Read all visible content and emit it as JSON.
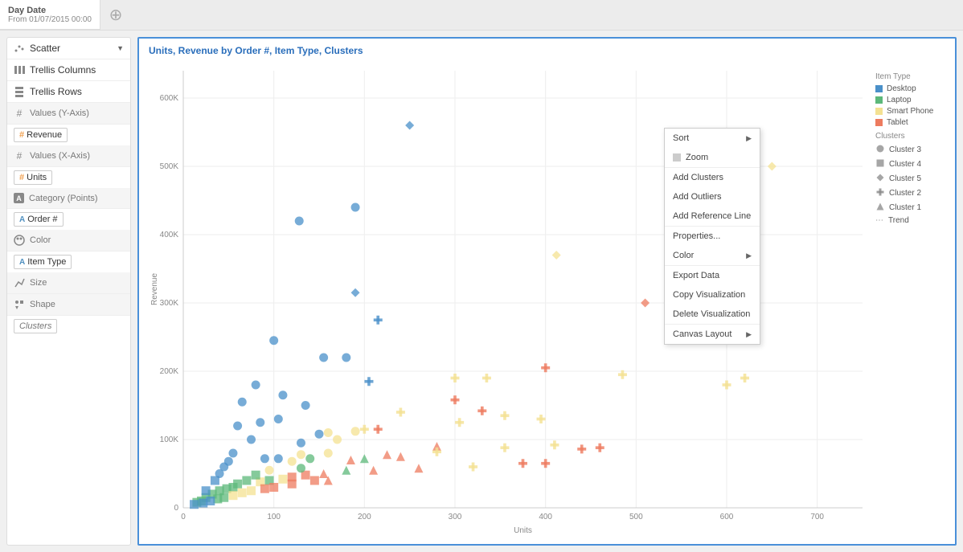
{
  "topbar": {
    "filter_title": "Day Date",
    "filter_sub": "From 01/07/2015 00:00"
  },
  "sidebar": {
    "viz_type": "Scatter",
    "trellis_cols": "Trellis Columns",
    "trellis_rows": "Trellis Rows",
    "y_axis_label": "Values (Y-Axis)",
    "y_axis_chip": "Revenue",
    "x_axis_label": "Values (X-Axis)",
    "x_axis_chip": "Units",
    "category_label": "Category (Points)",
    "category_chip": "Order #",
    "color_label": "Color",
    "color_chip": "Item Type",
    "size_label": "Size",
    "shape_label": "Shape",
    "shape_chip": "Clusters"
  },
  "chart": {
    "title": "Units, Revenue by Order #, Item Type, Clusters",
    "xlabel": "Units",
    "ylabel": "Revenue"
  },
  "legend": {
    "item_type_title": "Item Type",
    "item_types": [
      {
        "label": "Desktop",
        "color": "#4a90c9"
      },
      {
        "label": "Laptop",
        "color": "#5cb87a"
      },
      {
        "label": "Smart Phone",
        "color": "#f4e192"
      },
      {
        "label": "Tablet",
        "color": "#ed7b5f"
      }
    ],
    "clusters_title": "Clusters",
    "clusters": [
      {
        "label": "Cluster 3",
        "shape": "circle"
      },
      {
        "label": "Cluster 4",
        "shape": "square"
      },
      {
        "label": "Cluster 5",
        "shape": "diamond"
      },
      {
        "label": "Cluster 2",
        "shape": "plus"
      },
      {
        "label": "Cluster 1",
        "shape": "triangle"
      }
    ],
    "trend_label": "Trend"
  },
  "context_menu": {
    "sort": "Sort",
    "zoom": "Zoom",
    "add_clusters": "Add Clusters",
    "add_outliers": "Add Outliers",
    "add_ref": "Add Reference Line",
    "properties": "Properties...",
    "color": "Color",
    "export": "Export Data",
    "copy": "Copy Visualization",
    "delete": "Delete Visualization",
    "canvas": "Canvas Layout"
  },
  "chart_data": {
    "type": "scatter",
    "xlabel": "Units",
    "ylabel": "Revenue",
    "xlim": [
      0,
      750
    ],
    "ylim": [
      0,
      640000
    ],
    "x_ticks": [
      0,
      100,
      200,
      300,
      400,
      500,
      600,
      700
    ],
    "y_ticks": [
      0,
      100000,
      200000,
      300000,
      400000,
      500000,
      600000
    ],
    "y_tick_labels": [
      "0",
      "100K",
      "200K",
      "300K",
      "400K",
      "500K",
      "600K"
    ],
    "colors": {
      "Desktop": "#4a90c9",
      "Laptop": "#5cb87a",
      "Smart Phone": "#f4e192",
      "Tablet": "#ed7b5f"
    },
    "shapes": {
      "Cluster 1": "triangle",
      "Cluster 2": "plus",
      "Cluster 3": "circle",
      "Cluster 4": "square",
      "Cluster 5": "diamond"
    },
    "points": [
      {
        "x": 250,
        "y": 560000,
        "type": "Desktop",
        "cluster": "Cluster 5"
      },
      {
        "x": 650,
        "y": 500000,
        "type": "Smart Phone",
        "cluster": "Cluster 5"
      },
      {
        "x": 190,
        "y": 440000,
        "type": "Desktop",
        "cluster": "Cluster 3"
      },
      {
        "x": 128,
        "y": 420000,
        "type": "Desktop",
        "cluster": "Cluster 3"
      },
      {
        "x": 412,
        "y": 370000,
        "type": "Smart Phone",
        "cluster": "Cluster 5"
      },
      {
        "x": 560,
        "y": 340000,
        "type": "Smart Phone",
        "cluster": "Cluster 5"
      },
      {
        "x": 190,
        "y": 315000,
        "type": "Desktop",
        "cluster": "Cluster 5"
      },
      {
        "x": 510,
        "y": 300000,
        "type": "Tablet",
        "cluster": "Cluster 5"
      },
      {
        "x": 215,
        "y": 275000,
        "type": "Desktop",
        "cluster": "Cluster 2"
      },
      {
        "x": 100,
        "y": 245000,
        "type": "Desktop",
        "cluster": "Cluster 3"
      },
      {
        "x": 155,
        "y": 220000,
        "type": "Desktop",
        "cluster": "Cluster 3"
      },
      {
        "x": 180,
        "y": 220000,
        "type": "Desktop",
        "cluster": "Cluster 3"
      },
      {
        "x": 400,
        "y": 205000,
        "type": "Tablet",
        "cluster": "Cluster 2"
      },
      {
        "x": 485,
        "y": 195000,
        "type": "Smart Phone",
        "cluster": "Cluster 2"
      },
      {
        "x": 620,
        "y": 190000,
        "type": "Smart Phone",
        "cluster": "Cluster 2"
      },
      {
        "x": 335,
        "y": 190000,
        "type": "Smart Phone",
        "cluster": "Cluster 2"
      },
      {
        "x": 300,
        "y": 190000,
        "type": "Smart Phone",
        "cluster": "Cluster 2"
      },
      {
        "x": 80,
        "y": 180000,
        "type": "Desktop",
        "cluster": "Cluster 3"
      },
      {
        "x": 205,
        "y": 185000,
        "type": "Desktop",
        "cluster": "Cluster 2"
      },
      {
        "x": 600,
        "y": 180000,
        "type": "Smart Phone",
        "cluster": "Cluster 2"
      },
      {
        "x": 300,
        "y": 158000,
        "type": "Tablet",
        "cluster": "Cluster 2"
      },
      {
        "x": 110,
        "y": 165000,
        "type": "Desktop",
        "cluster": "Cluster 3"
      },
      {
        "x": 65,
        "y": 155000,
        "type": "Desktop",
        "cluster": "Cluster 3"
      },
      {
        "x": 135,
        "y": 150000,
        "type": "Desktop",
        "cluster": "Cluster 3"
      },
      {
        "x": 240,
        "y": 140000,
        "type": "Smart Phone",
        "cluster": "Cluster 2"
      },
      {
        "x": 330,
        "y": 142000,
        "type": "Tablet",
        "cluster": "Cluster 2"
      },
      {
        "x": 355,
        "y": 135000,
        "type": "Smart Phone",
        "cluster": "Cluster 2"
      },
      {
        "x": 395,
        "y": 130000,
        "type": "Smart Phone",
        "cluster": "Cluster 2"
      },
      {
        "x": 305,
        "y": 125000,
        "type": "Smart Phone",
        "cluster": "Cluster 2"
      },
      {
        "x": 85,
        "y": 125000,
        "type": "Desktop",
        "cluster": "Cluster 3"
      },
      {
        "x": 105,
        "y": 130000,
        "type": "Desktop",
        "cluster": "Cluster 3"
      },
      {
        "x": 60,
        "y": 120000,
        "type": "Desktop",
        "cluster": "Cluster 3"
      },
      {
        "x": 215,
        "y": 115000,
        "type": "Tablet",
        "cluster": "Cluster 2"
      },
      {
        "x": 200,
        "y": 115000,
        "type": "Smart Phone",
        "cluster": "Cluster 2"
      },
      {
        "x": 190,
        "y": 112000,
        "type": "Smart Phone",
        "cluster": "Cluster 3"
      },
      {
        "x": 160,
        "y": 110000,
        "type": "Smart Phone",
        "cluster": "Cluster 3"
      },
      {
        "x": 150,
        "y": 108000,
        "type": "Desktop",
        "cluster": "Cluster 3"
      },
      {
        "x": 170,
        "y": 100000,
        "type": "Smart Phone",
        "cluster": "Cluster 3"
      },
      {
        "x": 130,
        "y": 95000,
        "type": "Desktop",
        "cluster": "Cluster 3"
      },
      {
        "x": 75,
        "y": 100000,
        "type": "Desktop",
        "cluster": "Cluster 3"
      },
      {
        "x": 280,
        "y": 90000,
        "type": "Tablet",
        "cluster": "Cluster 1"
      },
      {
        "x": 410,
        "y": 92000,
        "type": "Smart Phone",
        "cluster": "Cluster 2"
      },
      {
        "x": 355,
        "y": 88000,
        "type": "Smart Phone",
        "cluster": "Cluster 2"
      },
      {
        "x": 460,
        "y": 88000,
        "type": "Tablet",
        "cluster": "Cluster 2"
      },
      {
        "x": 440,
        "y": 86000,
        "type": "Tablet",
        "cluster": "Cluster 2"
      },
      {
        "x": 280,
        "y": 82000,
        "type": "Smart Phone",
        "cluster": "Cluster 2"
      },
      {
        "x": 225,
        "y": 78000,
        "type": "Tablet",
        "cluster": "Cluster 1"
      },
      {
        "x": 240,
        "y": 75000,
        "type": "Tablet",
        "cluster": "Cluster 1"
      },
      {
        "x": 200,
        "y": 72000,
        "type": "Laptop",
        "cluster": "Cluster 1"
      },
      {
        "x": 185,
        "y": 70000,
        "type": "Tablet",
        "cluster": "Cluster 1"
      },
      {
        "x": 160,
        "y": 80000,
        "type": "Smart Phone",
        "cluster": "Cluster 3"
      },
      {
        "x": 130,
        "y": 78000,
        "type": "Smart Phone",
        "cluster": "Cluster 3"
      },
      {
        "x": 140,
        "y": 72000,
        "type": "Laptop",
        "cluster": "Cluster 3"
      },
      {
        "x": 120,
        "y": 68000,
        "type": "Smart Phone",
        "cluster": "Cluster 3"
      },
      {
        "x": 105,
        "y": 72000,
        "type": "Desktop",
        "cluster": "Cluster 3"
      },
      {
        "x": 90,
        "y": 72000,
        "type": "Desktop",
        "cluster": "Cluster 3"
      },
      {
        "x": 55,
        "y": 80000,
        "type": "Desktop",
        "cluster": "Cluster 3"
      },
      {
        "x": 50,
        "y": 68000,
        "type": "Desktop",
        "cluster": "Cluster 3"
      },
      {
        "x": 45,
        "y": 60000,
        "type": "Desktop",
        "cluster": "Cluster 3"
      },
      {
        "x": 40,
        "y": 50000,
        "type": "Desktop",
        "cluster": "Cluster 3"
      },
      {
        "x": 35,
        "y": 40000,
        "type": "Desktop",
        "cluster": "Cluster 4"
      },
      {
        "x": 400,
        "y": 65000,
        "type": "Tablet",
        "cluster": "Cluster 2"
      },
      {
        "x": 375,
        "y": 65000,
        "type": "Tablet",
        "cluster": "Cluster 2"
      },
      {
        "x": 320,
        "y": 60000,
        "type": "Smart Phone",
        "cluster": "Cluster 2"
      },
      {
        "x": 260,
        "y": 58000,
        "type": "Tablet",
        "cluster": "Cluster 1"
      },
      {
        "x": 210,
        "y": 55000,
        "type": "Tablet",
        "cluster": "Cluster 1"
      },
      {
        "x": 180,
        "y": 55000,
        "type": "Laptop",
        "cluster": "Cluster 1"
      },
      {
        "x": 155,
        "y": 50000,
        "type": "Tablet",
        "cluster": "Cluster 1"
      },
      {
        "x": 135,
        "y": 48000,
        "type": "Tablet",
        "cluster": "Cluster 4"
      },
      {
        "x": 120,
        "y": 45000,
        "type": "Tablet",
        "cluster": "Cluster 4"
      },
      {
        "x": 110,
        "y": 42000,
        "type": "Smart Phone",
        "cluster": "Cluster 4"
      },
      {
        "x": 95,
        "y": 40000,
        "type": "Laptop",
        "cluster": "Cluster 4"
      },
      {
        "x": 85,
        "y": 38000,
        "type": "Smart Phone",
        "cluster": "Cluster 4"
      },
      {
        "x": 70,
        "y": 40000,
        "type": "Laptop",
        "cluster": "Cluster 4"
      },
      {
        "x": 60,
        "y": 35000,
        "type": "Laptop",
        "cluster": "Cluster 4"
      },
      {
        "x": 55,
        "y": 30000,
        "type": "Laptop",
        "cluster": "Cluster 4"
      },
      {
        "x": 48,
        "y": 28000,
        "type": "Laptop",
        "cluster": "Cluster 4"
      },
      {
        "x": 40,
        "y": 25000,
        "type": "Laptop",
        "cluster": "Cluster 4"
      },
      {
        "x": 32,
        "y": 20000,
        "type": "Laptop",
        "cluster": "Cluster 4"
      },
      {
        "x": 25,
        "y": 15000,
        "type": "Laptop",
        "cluster": "Cluster 4"
      },
      {
        "x": 20,
        "y": 10000,
        "type": "Laptop",
        "cluster": "Cluster 4"
      },
      {
        "x": 15,
        "y": 8000,
        "type": "Laptop",
        "cluster": "Cluster 4"
      },
      {
        "x": 12,
        "y": 5000,
        "type": "Desktop",
        "cluster": "Cluster 4"
      },
      {
        "x": 130,
        "y": 58000,
        "type": "Laptop",
        "cluster": "Cluster 3"
      },
      {
        "x": 95,
        "y": 55000,
        "type": "Smart Phone",
        "cluster": "Cluster 3"
      },
      {
        "x": 80,
        "y": 48000,
        "type": "Laptop",
        "cluster": "Cluster 4"
      },
      {
        "x": 145,
        "y": 40000,
        "type": "Tablet",
        "cluster": "Cluster 4"
      },
      {
        "x": 160,
        "y": 40000,
        "type": "Tablet",
        "cluster": "Cluster 1"
      },
      {
        "x": 120,
        "y": 35000,
        "type": "Tablet",
        "cluster": "Cluster 4"
      },
      {
        "x": 100,
        "y": 30000,
        "type": "Tablet",
        "cluster": "Cluster 4"
      },
      {
        "x": 90,
        "y": 28000,
        "type": "Tablet",
        "cluster": "Cluster 4"
      },
      {
        "x": 75,
        "y": 25000,
        "type": "Smart Phone",
        "cluster": "Cluster 4"
      },
      {
        "x": 65,
        "y": 22000,
        "type": "Smart Phone",
        "cluster": "Cluster 4"
      },
      {
        "x": 55,
        "y": 18000,
        "type": "Smart Phone",
        "cluster": "Cluster 4"
      },
      {
        "x": 45,
        "y": 15000,
        "type": "Laptop",
        "cluster": "Cluster 4"
      },
      {
        "x": 38,
        "y": 13000,
        "type": "Laptop",
        "cluster": "Cluster 4"
      },
      {
        "x": 30,
        "y": 10000,
        "type": "Desktop",
        "cluster": "Cluster 4"
      },
      {
        "x": 22,
        "y": 7000,
        "type": "Desktop",
        "cluster": "Cluster 4"
      },
      {
        "x": 25,
        "y": 25000,
        "type": "Desktop",
        "cluster": "Cluster 4"
      }
    ]
  }
}
